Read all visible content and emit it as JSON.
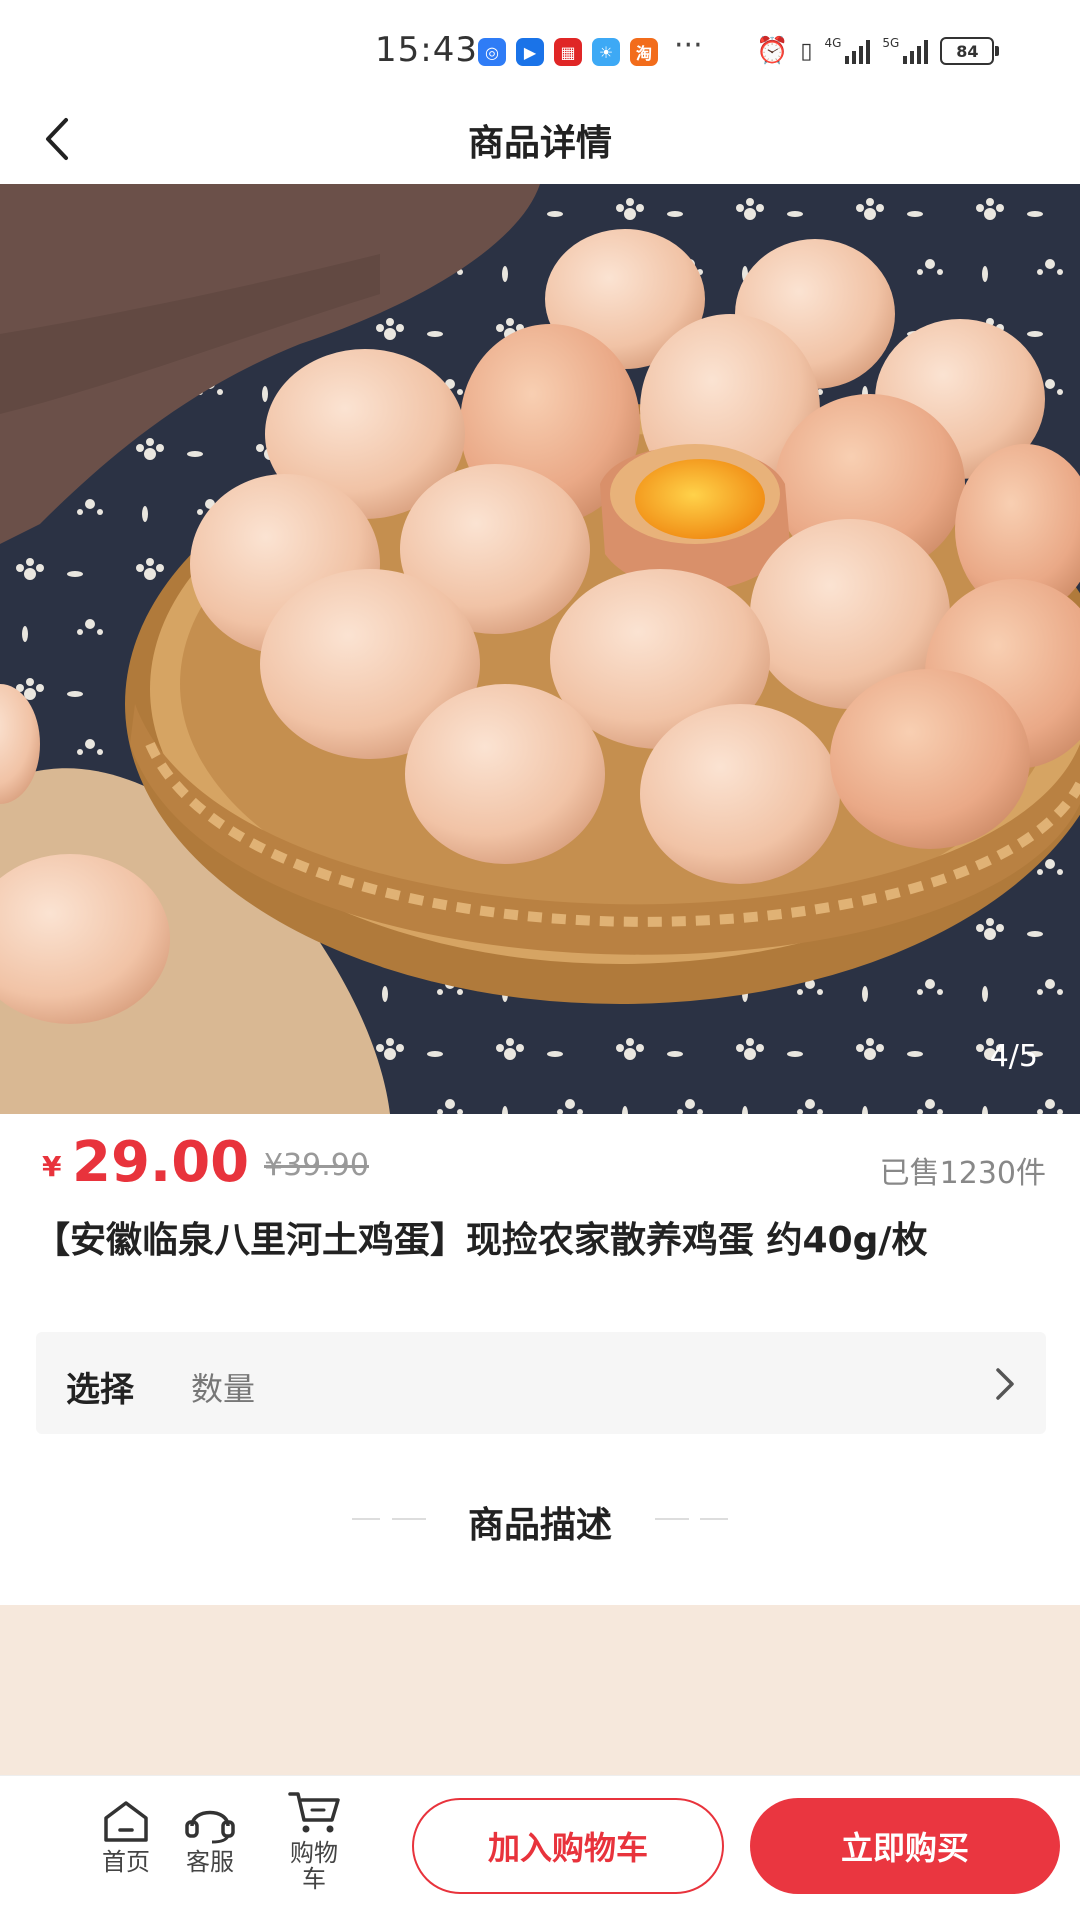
{
  "status": {
    "time": "15:43",
    "battery": "84",
    "network_1": "4G",
    "network_2": "5G",
    "more": "···"
  },
  "nav": {
    "title": "商品详情"
  },
  "gallery": {
    "counter": "4/5"
  },
  "product": {
    "currency": "¥",
    "price": "29.00",
    "original_price": "¥39.90",
    "sold": "已售1230件",
    "title": "【安徽临泉八里河土鸡蛋】现捡农家散养鸡蛋 约40g/枚"
  },
  "select": {
    "label": "选择",
    "value": "数量"
  },
  "description": {
    "title": "商品描述"
  },
  "bottom": {
    "home_label": "首页",
    "service_label": "客服",
    "cart_label": "购物车",
    "add_to_cart": "加入购物车",
    "buy_now": "立即购买"
  },
  "colors": {
    "accent": "#e8333c",
    "muted": "#999999"
  }
}
